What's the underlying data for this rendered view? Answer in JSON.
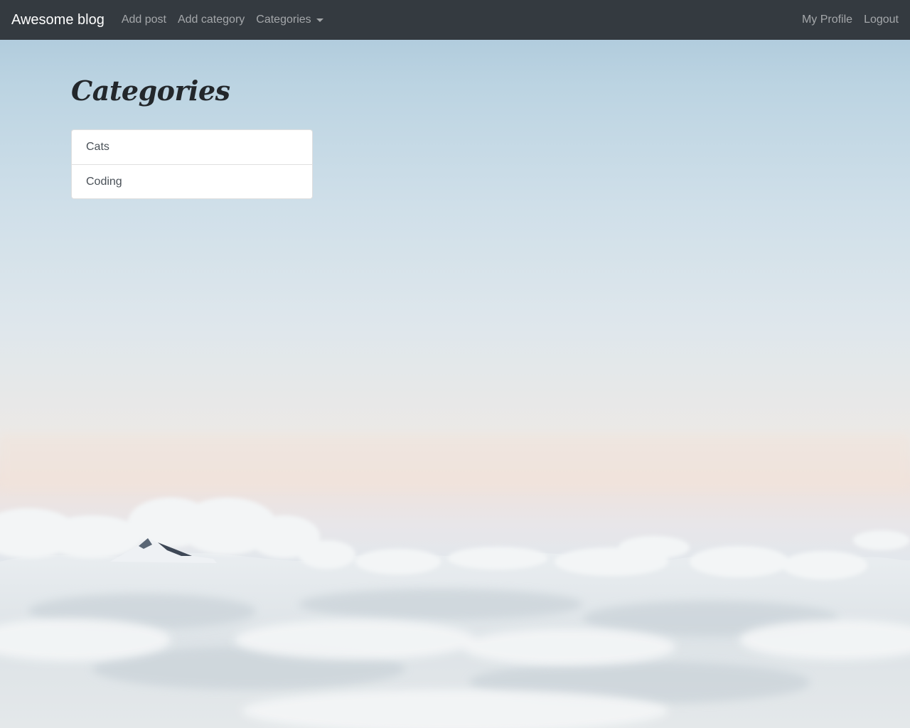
{
  "navbar": {
    "brand": "Awesome blog",
    "left_links": [
      {
        "label": "Add post"
      },
      {
        "label": "Add category"
      },
      {
        "label": "Categories"
      }
    ],
    "right_links": [
      {
        "label": "My Profile"
      },
      {
        "label": "Logout"
      }
    ],
    "background": "#343a40"
  },
  "main": {
    "title": "Categories",
    "categories": [
      {
        "label": "Cats"
      },
      {
        "label": "Coding"
      }
    ]
  },
  "background": {
    "icons": [
      "clouds-landscape-image",
      "mountain-peak-image"
    ]
  }
}
